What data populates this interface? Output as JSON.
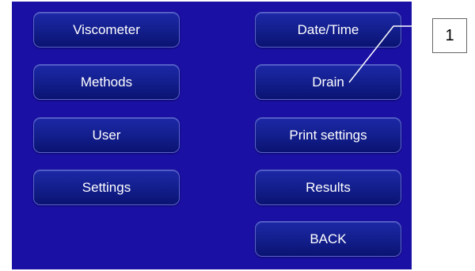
{
  "menu": {
    "left": [
      "Viscometer",
      "Methods",
      "User",
      "Settings"
    ],
    "right": [
      "Date/Time",
      "Drain",
      "Print settings",
      "Results",
      "BACK"
    ]
  },
  "callout": {
    "label": "1"
  },
  "colors": {
    "screen_background": "#1a10a4",
    "button_fill": "#142090",
    "button_border": "#5a63c8",
    "button_text": "#ffffff"
  }
}
